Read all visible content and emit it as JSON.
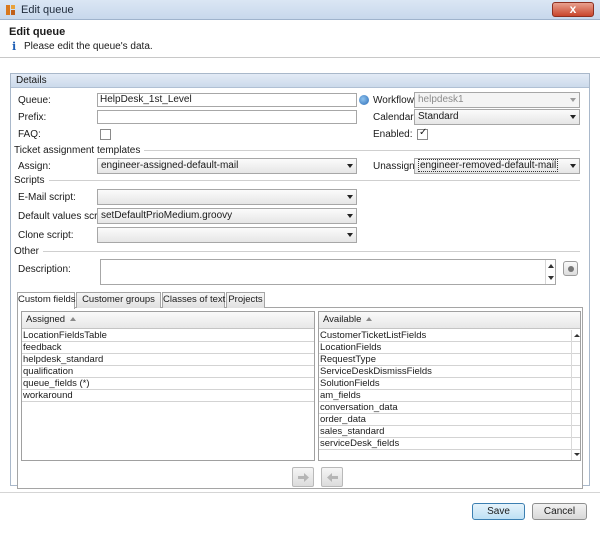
{
  "window": {
    "title": "Edit queue",
    "close_label": "x"
  },
  "header": {
    "title": "Edit queue",
    "subtitle": "Please edit the queue's data."
  },
  "details": {
    "section_title": "Details",
    "queue_label": "Queue:",
    "queue_value": "HelpDesk_1st_Level",
    "prefix_label": "Prefix:",
    "prefix_value": "",
    "faq_label": "FAQ:",
    "faq_checked": false,
    "workflow_label": "Workflow:",
    "workflow_value": "helpdesk1",
    "calendar_label": "Calendar:",
    "calendar_value": "Standard",
    "enabled_label": "Enabled:",
    "enabled_checked": true
  },
  "ticket_templates": {
    "section_title": "Ticket assignment templates",
    "assign_label": "Assign:",
    "assign_value": "engineer-assigned-default-mail",
    "unassign_label": "Unassign:",
    "unassign_value": "engineer-removed-default-mail"
  },
  "scripts": {
    "section_title": "Scripts",
    "email_label": "E-Mail script:",
    "email_value": "",
    "default_values_label": "Default values script:",
    "default_values_value": "setDefaultPrioMedium.groovy",
    "clone_label": "Clone script:",
    "clone_value": ""
  },
  "other": {
    "section_title": "Other",
    "description_label": "Description:",
    "description_value": ""
  },
  "tabs": [
    {
      "label": "Custom fields",
      "active": true
    },
    {
      "label": "Customer groups",
      "active": false
    },
    {
      "label": "Classes of text",
      "active": false
    },
    {
      "label": "Projects",
      "active": false
    }
  ],
  "assigned": {
    "header": "Assigned",
    "items": [
      "LocationFieldsTable",
      "feedback",
      "helpdesk_standard",
      "qualification",
      "queue_fields (*)",
      "workaround"
    ]
  },
  "available": {
    "header": "Available",
    "items": [
      "CustomerTicketListFields",
      "LocationFields",
      "RequestType",
      "ServiceDeskDismissFields",
      "SolutionFields",
      "am_fields",
      "conversation_data",
      "order_data",
      "sales_standard",
      "serviceDesk_fields"
    ]
  },
  "buttons": {
    "save": "Save",
    "cancel": "Cancel"
  },
  "colors": {
    "accent": "#3c7fb1",
    "header_bar": "#ccdaeb",
    "close_button": "#c9452c"
  }
}
